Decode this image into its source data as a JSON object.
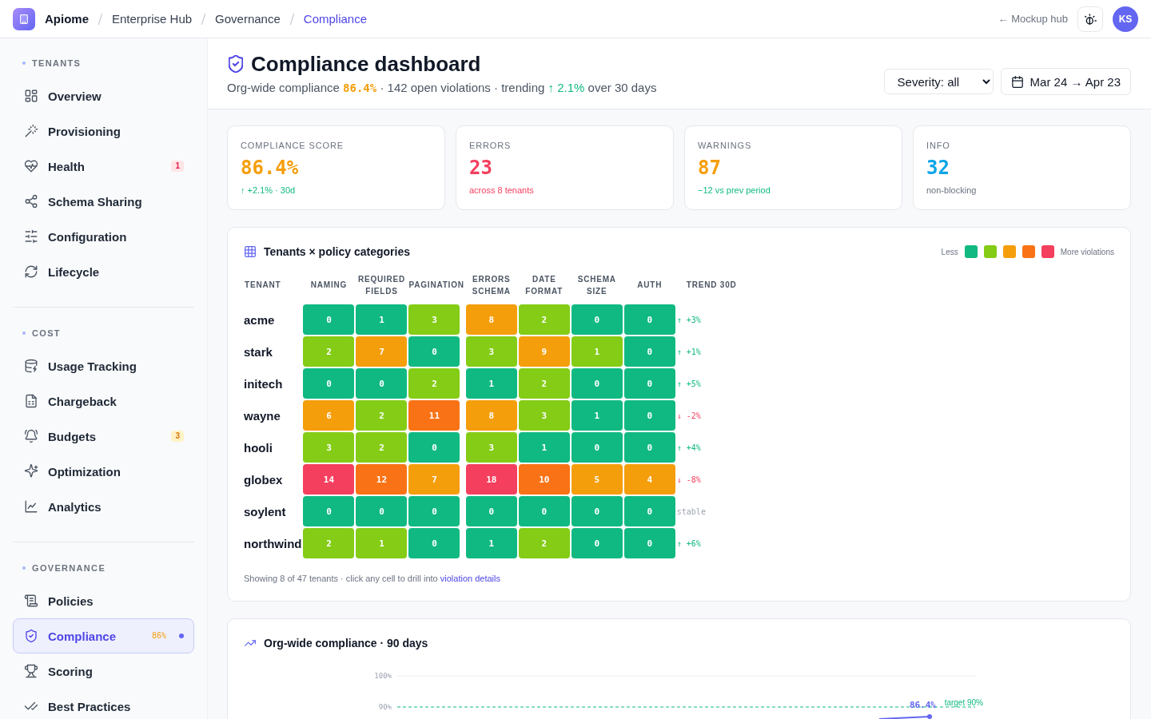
{
  "breadcrumbs": {
    "items": [
      {
        "label": "Apiome",
        "kind": "root",
        "current": false
      },
      {
        "label": "Enterprise Hub",
        "kind": "page",
        "current": false
      },
      {
        "label": "Governance",
        "kind": "page",
        "current": false
      },
      {
        "label": "Compliance",
        "kind": "page",
        "current": true
      }
    ]
  },
  "top_links": {
    "back": "← Mockup hub"
  },
  "user": {
    "initials": "KS"
  },
  "sidebar": {
    "sections": [
      {
        "title": "TENANTS",
        "items": [
          {
            "label": "Overview",
            "selected": false
          },
          {
            "label": "Provisioning",
            "selected": false
          },
          {
            "label": "Health",
            "selected": false,
            "badge": {
              "text": "1",
              "kind": "alert"
            }
          },
          {
            "label": "Schema Sharing",
            "selected": false
          },
          {
            "label": "Configuration",
            "selected": false
          },
          {
            "label": "Lifecycle",
            "selected": false
          }
        ]
      },
      {
        "title": "COST",
        "items": [
          {
            "label": "Usage Tracking",
            "selected": false
          },
          {
            "label": "Chargeback",
            "selected": false
          },
          {
            "label": "Budgets",
            "selected": false,
            "badge": {
              "text": "3",
              "kind": "warning"
            }
          },
          {
            "label": "Optimization",
            "selected": false
          },
          {
            "label": "Analytics",
            "selected": false
          }
        ]
      },
      {
        "title": "GOVERNANCE",
        "items": [
          {
            "label": "Policies",
            "selected": false
          },
          {
            "label": "Compliance",
            "selected": true,
            "badge": {
              "text": "86%",
              "kind": "score"
            }
          },
          {
            "label": "Scoring",
            "selected": false
          },
          {
            "label": "Best Practices",
            "selected": false
          }
        ]
      }
    ]
  },
  "header": {
    "title": "Compliance dashboard",
    "subtitle": {
      "lead": "Org-wide compliance",
      "score": "86.4%",
      "middle": "· 142 open violations · trending",
      "trend": "↑ 2.1%",
      "tail": "over 30 days"
    },
    "severity_select": {
      "value": "Severity: all"
    },
    "date_range": {
      "label": "Mar 24 → Apr 23"
    }
  },
  "stats": [
    {
      "label": "COMPLIANCE SCORE",
      "value": "86.4%",
      "color": "#f59e0b",
      "note": {
        "text": "↑ +2.1% · 30d",
        "color": "#10b981"
      }
    },
    {
      "label": "ERRORS",
      "value": "23",
      "color": "#f43f5e",
      "note": {
        "text": "across 8 tenants",
        "color": "#f43f5e"
      }
    },
    {
      "label": "WARNINGS",
      "value": "87",
      "color": "#f59e0b",
      "note": {
        "text": "−12 vs prev period",
        "color": "#10b981"
      }
    },
    {
      "label": "INFO",
      "value": "32",
      "color": "#0ea5e9",
      "note": {
        "text": "non-blocking",
        "color": "#6b7280"
      }
    }
  ],
  "heatmap": {
    "title": "Tenants × policy categories",
    "legend": {
      "low": "Less",
      "high": "More violations",
      "swatches": [
        {
          "color": "#10b981"
        },
        {
          "color": "#84cc16"
        },
        {
          "color": "#f59e0b"
        },
        {
          "color": "#f97316"
        },
        {
          "color": "#f43f5e"
        }
      ]
    },
    "columns": {
      "tenant": "TENANT",
      "categories": [
        "NAMING",
        "REQUIRED FIELDS",
        "PAGINATION",
        "ERRORS SCHEMA",
        "DATE FORMAT",
        "SCHEMA SIZE",
        "AUTH"
      ],
      "trend": "TREND 30D"
    },
    "rows": [
      {
        "tenant": "acme",
        "cells": [
          {
            "value": "0",
            "color": "#10b981"
          },
          {
            "value": "1",
            "color": "#10b981"
          },
          {
            "value": "3",
            "color": "#84cc16"
          },
          {
            "value": "8",
            "color": "#f59e0b"
          },
          {
            "value": "2",
            "color": "#84cc16"
          },
          {
            "value": "0",
            "color": "#10b981"
          },
          {
            "value": "0",
            "color": "#10b981"
          }
        ],
        "trend": {
          "text": "↑ +3%",
          "color": "#10b981"
        }
      },
      {
        "tenant": "stark",
        "cells": [
          {
            "value": "2",
            "color": "#84cc16"
          },
          {
            "value": "7",
            "color": "#f59e0b"
          },
          {
            "value": "0",
            "color": "#10b981"
          },
          {
            "value": "3",
            "color": "#84cc16"
          },
          {
            "value": "9",
            "color": "#f59e0b"
          },
          {
            "value": "1",
            "color": "#84cc16"
          },
          {
            "value": "0",
            "color": "#10b981"
          }
        ],
        "trend": {
          "text": "↑ +1%",
          "color": "#10b981"
        }
      },
      {
        "tenant": "initech",
        "cells": [
          {
            "value": "0",
            "color": "#10b981"
          },
          {
            "value": "0",
            "color": "#10b981"
          },
          {
            "value": "2",
            "color": "#84cc16"
          },
          {
            "value": "1",
            "color": "#10b981"
          },
          {
            "value": "2",
            "color": "#84cc16"
          },
          {
            "value": "0",
            "color": "#10b981"
          },
          {
            "value": "0",
            "color": "#10b981"
          }
        ],
        "trend": {
          "text": "↑ +5%",
          "color": "#10b981"
        }
      },
      {
        "tenant": "wayne",
        "cells": [
          {
            "value": "6",
            "color": "#f59e0b"
          },
          {
            "value": "2",
            "color": "#84cc16"
          },
          {
            "value": "11",
            "color": "#f97316"
          },
          {
            "value": "8",
            "color": "#f59e0b"
          },
          {
            "value": "3",
            "color": "#84cc16"
          },
          {
            "value": "1",
            "color": "#10b981"
          },
          {
            "value": "0",
            "color": "#10b981"
          }
        ],
        "trend": {
          "text": "↓ -2%",
          "color": "#f43f5e"
        }
      },
      {
        "tenant": "hooli",
        "cells": [
          {
            "value": "3",
            "color": "#84cc16"
          },
          {
            "value": "2",
            "color": "#84cc16"
          },
          {
            "value": "0",
            "color": "#10b981"
          },
          {
            "value": "3",
            "color": "#84cc16"
          },
          {
            "value": "1",
            "color": "#10b981"
          },
          {
            "value": "0",
            "color": "#10b981"
          },
          {
            "value": "0",
            "color": "#10b981"
          }
        ],
        "trend": {
          "text": "↑ +4%",
          "color": "#10b981"
        }
      },
      {
        "tenant": "globex",
        "cells": [
          {
            "value": "14",
            "color": "#f43f5e"
          },
          {
            "value": "12",
            "color": "#f97316"
          },
          {
            "value": "7",
            "color": "#f59e0b"
          },
          {
            "value": "18",
            "color": "#f43f5e"
          },
          {
            "value": "10",
            "color": "#f97316"
          },
          {
            "value": "5",
            "color": "#f59e0b"
          },
          {
            "value": "4",
            "color": "#f59e0b"
          }
        ],
        "trend": {
          "text": "↓ -8%",
          "color": "#f43f5e"
        }
      },
      {
        "tenant": "soylent",
        "cells": [
          {
            "value": "0",
            "color": "#10b981"
          },
          {
            "value": "0",
            "color": "#10b981"
          },
          {
            "value": "0",
            "color": "#10b981"
          },
          {
            "value": "0",
            "color": "#10b981"
          },
          {
            "value": "0",
            "color": "#10b981"
          },
          {
            "value": "0",
            "color": "#10b981"
          },
          {
            "value": "0",
            "color": "#10b981"
          }
        ],
        "trend": {
          "text": "stable",
          "color": "#9ca3af"
        }
      },
      {
        "tenant": "northwind",
        "cells": [
          {
            "value": "2",
            "color": "#84cc16"
          },
          {
            "value": "1",
            "color": "#84cc16"
          },
          {
            "value": "0",
            "color": "#10b981"
          },
          {
            "value": "1",
            "color": "#10b981"
          },
          {
            "value": "2",
            "color": "#84cc16"
          },
          {
            "value": "0",
            "color": "#10b981"
          },
          {
            "value": "0",
            "color": "#10b981"
          }
        ],
        "trend": {
          "text": "↑ +6%",
          "color": "#10b981"
        }
      }
    ],
    "caption": {
      "text": "Showing 8 of 47 tenants · click any cell to drill into",
      "link": "violation details"
    }
  },
  "trend_chart": {
    "title": "Org-wide compliance · 90 days",
    "axis_labels": [
      "100%",
      "90%"
    ],
    "target_label": "target 90%",
    "value_label": "86.4%"
  }
}
